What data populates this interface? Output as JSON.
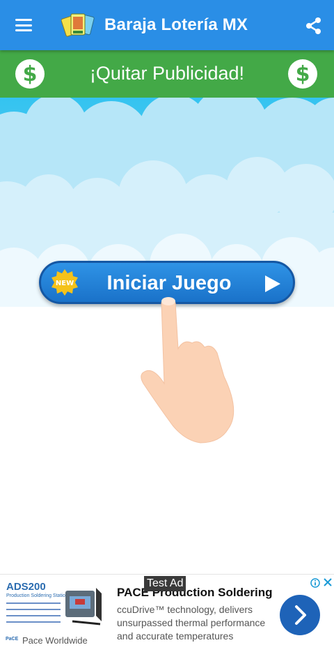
{
  "appbar": {
    "title": "Baraja Lotería MX",
    "menu_icon": "hamburger-menu-icon",
    "share_icon": "share-icon",
    "color": "#2a8ee6"
  },
  "remove_ads": {
    "label": "¡Quitar Publicidad!",
    "icon": "dollar-icon",
    "dollar_symbol": "$",
    "color": "#43a947"
  },
  "start": {
    "label": "Iniciar Juego",
    "badge": "NEW",
    "play_icon": "play-icon"
  },
  "ad": {
    "test_label": "Test Ad",
    "headline": "PACE Production Soldering",
    "body": "ccuDrive™ technology, delivers unsurpassed thermal performance and accurate temperatures",
    "advertiser": "Pace Worldwide",
    "image_brand": "ADS200",
    "image_subtitle": "Production Soldering Station",
    "cta_icon": "chevron-right-icon",
    "info_icon": "info-icon",
    "close_icon": "close-icon"
  }
}
